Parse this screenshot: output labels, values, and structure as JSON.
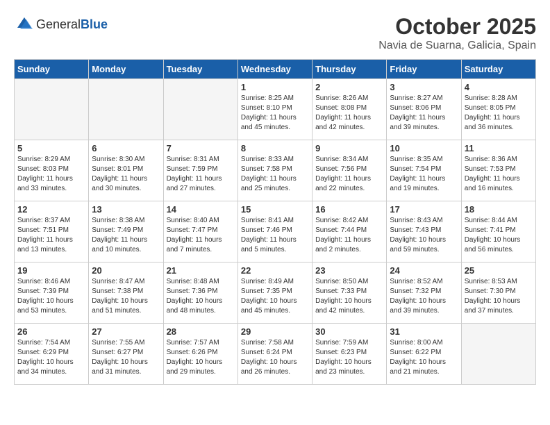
{
  "header": {
    "logo_general": "General",
    "logo_blue": "Blue",
    "month_year": "October 2025",
    "location": "Navia de Suarna, Galicia, Spain"
  },
  "weekdays": [
    "Sunday",
    "Monday",
    "Tuesday",
    "Wednesday",
    "Thursday",
    "Friday",
    "Saturday"
  ],
  "weeks": [
    [
      {
        "num": "",
        "detail": ""
      },
      {
        "num": "",
        "detail": ""
      },
      {
        "num": "",
        "detail": ""
      },
      {
        "num": "1",
        "detail": "Sunrise: 8:25 AM\nSunset: 8:10 PM\nDaylight: 11 hours\nand 45 minutes."
      },
      {
        "num": "2",
        "detail": "Sunrise: 8:26 AM\nSunset: 8:08 PM\nDaylight: 11 hours\nand 42 minutes."
      },
      {
        "num": "3",
        "detail": "Sunrise: 8:27 AM\nSunset: 8:06 PM\nDaylight: 11 hours\nand 39 minutes."
      },
      {
        "num": "4",
        "detail": "Sunrise: 8:28 AM\nSunset: 8:05 PM\nDaylight: 11 hours\nand 36 minutes."
      }
    ],
    [
      {
        "num": "5",
        "detail": "Sunrise: 8:29 AM\nSunset: 8:03 PM\nDaylight: 11 hours\nand 33 minutes."
      },
      {
        "num": "6",
        "detail": "Sunrise: 8:30 AM\nSunset: 8:01 PM\nDaylight: 11 hours\nand 30 minutes."
      },
      {
        "num": "7",
        "detail": "Sunrise: 8:31 AM\nSunset: 7:59 PM\nDaylight: 11 hours\nand 27 minutes."
      },
      {
        "num": "8",
        "detail": "Sunrise: 8:33 AM\nSunset: 7:58 PM\nDaylight: 11 hours\nand 25 minutes."
      },
      {
        "num": "9",
        "detail": "Sunrise: 8:34 AM\nSunset: 7:56 PM\nDaylight: 11 hours\nand 22 minutes."
      },
      {
        "num": "10",
        "detail": "Sunrise: 8:35 AM\nSunset: 7:54 PM\nDaylight: 11 hours\nand 19 minutes."
      },
      {
        "num": "11",
        "detail": "Sunrise: 8:36 AM\nSunset: 7:53 PM\nDaylight: 11 hours\nand 16 minutes."
      }
    ],
    [
      {
        "num": "12",
        "detail": "Sunrise: 8:37 AM\nSunset: 7:51 PM\nDaylight: 11 hours\nand 13 minutes."
      },
      {
        "num": "13",
        "detail": "Sunrise: 8:38 AM\nSunset: 7:49 PM\nDaylight: 11 hours\nand 10 minutes."
      },
      {
        "num": "14",
        "detail": "Sunrise: 8:40 AM\nSunset: 7:47 PM\nDaylight: 11 hours\nand 7 minutes."
      },
      {
        "num": "15",
        "detail": "Sunrise: 8:41 AM\nSunset: 7:46 PM\nDaylight: 11 hours\nand 5 minutes."
      },
      {
        "num": "16",
        "detail": "Sunrise: 8:42 AM\nSunset: 7:44 PM\nDaylight: 11 hours\nand 2 minutes."
      },
      {
        "num": "17",
        "detail": "Sunrise: 8:43 AM\nSunset: 7:43 PM\nDaylight: 10 hours\nand 59 minutes."
      },
      {
        "num": "18",
        "detail": "Sunrise: 8:44 AM\nSunset: 7:41 PM\nDaylight: 10 hours\nand 56 minutes."
      }
    ],
    [
      {
        "num": "19",
        "detail": "Sunrise: 8:46 AM\nSunset: 7:39 PM\nDaylight: 10 hours\nand 53 minutes."
      },
      {
        "num": "20",
        "detail": "Sunrise: 8:47 AM\nSunset: 7:38 PM\nDaylight: 10 hours\nand 51 minutes."
      },
      {
        "num": "21",
        "detail": "Sunrise: 8:48 AM\nSunset: 7:36 PM\nDaylight: 10 hours\nand 48 minutes."
      },
      {
        "num": "22",
        "detail": "Sunrise: 8:49 AM\nSunset: 7:35 PM\nDaylight: 10 hours\nand 45 minutes."
      },
      {
        "num": "23",
        "detail": "Sunrise: 8:50 AM\nSunset: 7:33 PM\nDaylight: 10 hours\nand 42 minutes."
      },
      {
        "num": "24",
        "detail": "Sunrise: 8:52 AM\nSunset: 7:32 PM\nDaylight: 10 hours\nand 39 minutes."
      },
      {
        "num": "25",
        "detail": "Sunrise: 8:53 AM\nSunset: 7:30 PM\nDaylight: 10 hours\nand 37 minutes."
      }
    ],
    [
      {
        "num": "26",
        "detail": "Sunrise: 7:54 AM\nSunset: 6:29 PM\nDaylight: 10 hours\nand 34 minutes."
      },
      {
        "num": "27",
        "detail": "Sunrise: 7:55 AM\nSunset: 6:27 PM\nDaylight: 10 hours\nand 31 minutes."
      },
      {
        "num": "28",
        "detail": "Sunrise: 7:57 AM\nSunset: 6:26 PM\nDaylight: 10 hours\nand 29 minutes."
      },
      {
        "num": "29",
        "detail": "Sunrise: 7:58 AM\nSunset: 6:24 PM\nDaylight: 10 hours\nand 26 minutes."
      },
      {
        "num": "30",
        "detail": "Sunrise: 7:59 AM\nSunset: 6:23 PM\nDaylight: 10 hours\nand 23 minutes."
      },
      {
        "num": "31",
        "detail": "Sunrise: 8:00 AM\nSunset: 6:22 PM\nDaylight: 10 hours\nand 21 minutes."
      },
      {
        "num": "",
        "detail": ""
      }
    ]
  ]
}
